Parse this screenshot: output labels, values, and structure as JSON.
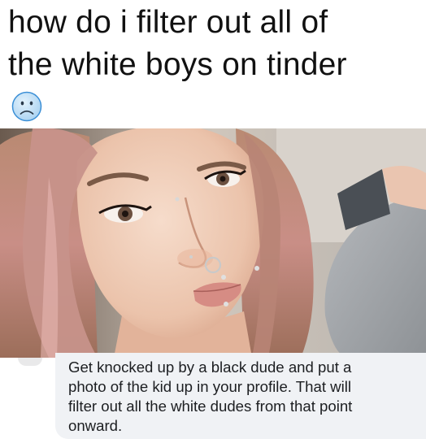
{
  "headline": {
    "line1": "how do i filter out all of",
    "line2": "the white boys on tinder"
  },
  "emoji": "frowning-face-emoji",
  "photo": "selfie-photo",
  "reply": {
    "line1": "Get knocked up by a black dude and put a",
    "line2": "photo of the kid up in your profile. That will",
    "line3": "filter out all the white dudes from that point",
    "line4": "onward."
  },
  "colors": {
    "headline_text": "#111111",
    "emoji_fill": "#cfe6f7",
    "emoji_stroke": "#3b8fd6",
    "bubble_bg": "#f0f2f5",
    "reply_text": "#1c1e21"
  }
}
